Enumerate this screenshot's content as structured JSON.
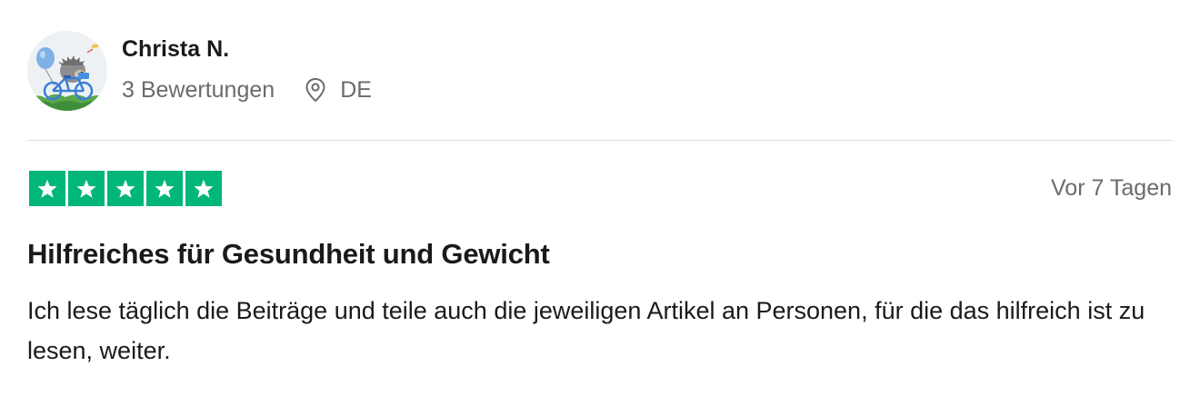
{
  "reviewer": {
    "name": "Christa N.",
    "review_count": "3 Bewertungen",
    "country": "DE",
    "avatar_icon": "avatar-hedgehog-bicycle"
  },
  "rating": {
    "stars": 5,
    "max": 5,
    "color": "#00b67a",
    "icon": "star-icon"
  },
  "review": {
    "date": "Vor 7 Tagen",
    "title": "Hilfreiches für Gesundheit und Gewicht",
    "body": "Ich lese täglich die Beiträge und teile auch die jeweiligen Artikel an Personen, für die das hilfreich ist zu lesen, weiter."
  },
  "icons": {
    "location": "location-pin-icon"
  }
}
